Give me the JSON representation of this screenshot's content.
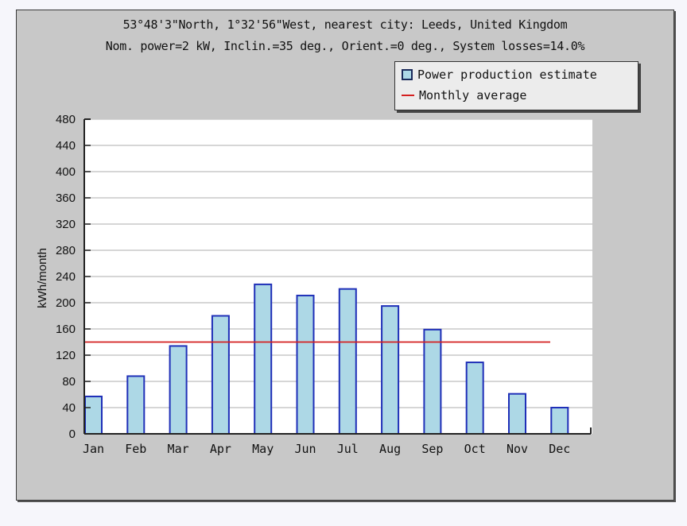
{
  "chart_data": {
    "type": "bar",
    "title": "53°48'3\"North, 1°32'56\"West, nearest city: Leeds, United Kingdom",
    "subtitle": "Nom. power=2 kW, Inclin.=35 deg., Orient.=0 deg., System losses=14.0%",
    "xlabel": "",
    "ylabel": "kWh/month",
    "ylim": [
      0,
      480
    ],
    "yticks": [
      0,
      40,
      80,
      120,
      160,
      200,
      240,
      280,
      320,
      360,
      400,
      440,
      480
    ],
    "categories": [
      "Jan",
      "Feb",
      "Mar",
      "Apr",
      "May",
      "Jun",
      "Jul",
      "Aug",
      "Sep",
      "Oct",
      "Nov",
      "Dec"
    ],
    "series": [
      {
        "name": "Power production estimate",
        "type": "bar",
        "values": [
          57,
          88,
          134,
          180,
          228,
          211,
          221,
          195,
          159,
          109,
          61,
          40
        ]
      },
      {
        "name": "Monthly average",
        "type": "line",
        "value": 140
      }
    ],
    "grid": true,
    "legend": "top-right",
    "colors": {
      "bar_fill": "#add8e6",
      "bar_border": "#1f2fb8",
      "average_line": "#d42020",
      "panel_background": "#c8c8c8",
      "plot_background": "#ffffff",
      "grid": "#c8c8c8"
    }
  }
}
